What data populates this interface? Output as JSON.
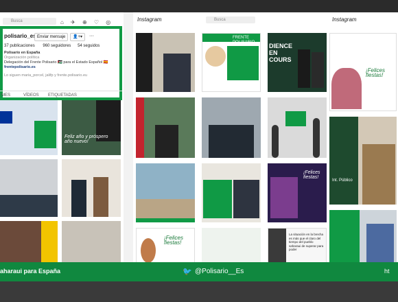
{
  "left_pane": {
    "search_placeholder": "Busca",
    "username": "polisario_es",
    "send_message": "Enviar mensaje",
    "follow_icon": "person-plus-icon",
    "more": "···",
    "stats": {
      "posts": "37 publicaciones",
      "followers": "960 seguidores",
      "following": "54 seguidos"
    },
    "bio": [
      "Polisario en España",
      "Organización política",
      "Delegación del Frente Polisario 🇪🇭 para el Estado Español 🇪🇸",
      "frentepolisario.es"
    ],
    "followed_by": "Lo siguen maria_porcel, jalifp y frente.polisario.eu",
    "tabs": [
      "MES",
      "VÍDEOS",
      "ETIQUETADAS"
    ]
  },
  "middle_pane": {
    "logo": "Instagram",
    "search_placeholder": "Busca"
  },
  "right_pane": {
    "logo": "Instagram"
  },
  "tile_text": {
    "frente": "FRENTE POLISARIO",
    "dience": "DIENCE EN COURS",
    "felices": "¡Felices fiestas!",
    "nuevo": "Feliz año y próspero año nuevo!",
    "felices2": "¡Felices fiestas!",
    "int_publico": "Int. Público",
    "situacion": "La situación en la brecha es más que el claro del tiempo del pueblo saharaui de superar para poder"
  },
  "footer": {
    "left": "aharaui para España",
    "twitter_icon": "twitter-icon",
    "handle": "@Polisario__Es",
    "right": "ht"
  },
  "colors": {
    "green": "#10883f",
    "accent": "#109a45"
  }
}
